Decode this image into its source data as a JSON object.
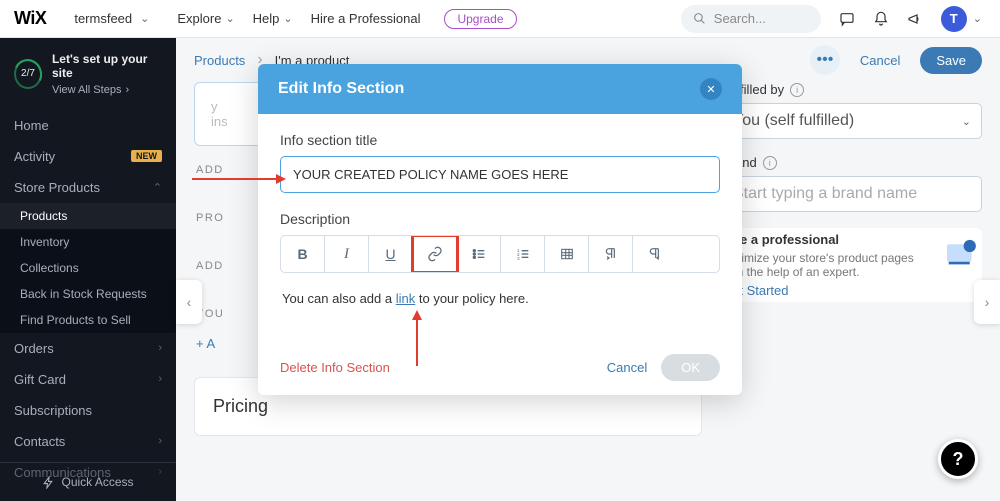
{
  "topbar": {
    "logo": "WiX",
    "site": "termsfeed",
    "nav": {
      "explore": "Explore",
      "help": "Help",
      "hire": "Hire a Professional"
    },
    "upgrade": "Upgrade",
    "search_placeholder": "Search...",
    "avatar_initial": "T"
  },
  "sidebar": {
    "progress": "2/7",
    "setup_title": "Let's set up your site",
    "view_steps": "View All Steps",
    "home": "Home",
    "activity": "Activity",
    "new_badge": "NEW",
    "store_products": "Store Products",
    "sub": {
      "products": "Products",
      "inventory": "Inventory",
      "collections": "Collections",
      "back_in_stock": "Back in Stock Requests",
      "find_products": "Find Products to Sell"
    },
    "orders": "Orders",
    "gift_card": "Gift Card",
    "subscriptions": "Subscriptions",
    "contacts": "Contacts",
    "communications": "Communications",
    "quick_access": "Quick Access"
  },
  "header": {
    "breadcrumb_root": "Products",
    "breadcrumb_current": "I'm a product",
    "more": "•••",
    "cancel": "Cancel",
    "save": "Save"
  },
  "left": {
    "box_l1": "y",
    "box_l2": "ins",
    "add_label": "ADD",
    "pro_label": "PRO",
    "you_label": "YOU",
    "add_new": "+  A",
    "pricing": "Pricing"
  },
  "right": {
    "fulfilled_label": "Fulfilled by",
    "fulfilled_value": "You (self fulfilled)",
    "brand_label": "Brand",
    "brand_placeholder": "Start typing a brand name",
    "pro_title": "Hire a professional",
    "pro_body": "Optimize your store's product pages with the help of an expert.",
    "get_started": "Get Started"
  },
  "modal": {
    "title": "Edit Info Section",
    "section_label": "Info section title",
    "section_value": "YOUR CREATED POLICY NAME GOES HERE",
    "description_label": "Description",
    "desc_pre": "You can also add a ",
    "desc_link": "link",
    "desc_post": " to your policy here.",
    "delete": "Delete Info Section",
    "cancel": "Cancel",
    "ok": "OK"
  },
  "help": "?",
  "colors": {
    "accent": "#3b7ab5",
    "modal_header": "#4aa3df",
    "danger": "#d9534f",
    "highlight": "#e33b2e"
  }
}
